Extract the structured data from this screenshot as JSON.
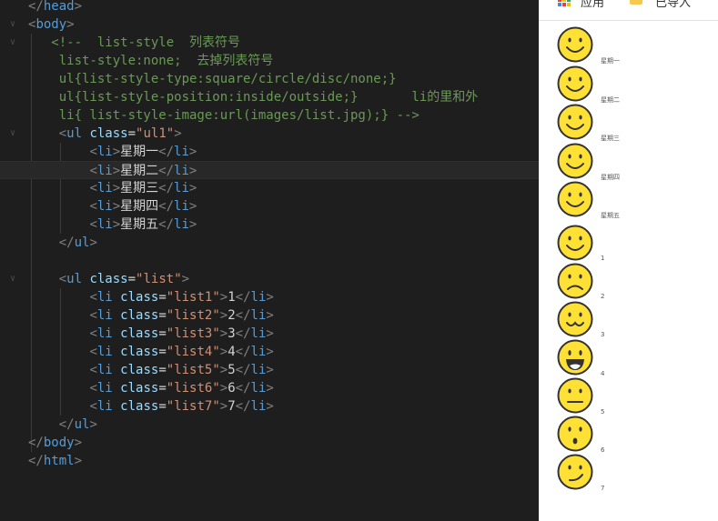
{
  "editor": {
    "lines": [
      [
        [
          "t",
          "</"
        ],
        [
          "tag",
          "head"
        ],
        [
          "t",
          ">"
        ]
      ],
      [
        [
          "t",
          "<"
        ],
        [
          "tag",
          "body"
        ],
        [
          "t",
          ">"
        ]
      ],
      [
        [
          "txt",
          "   "
        ],
        [
          "cmt",
          "<!--  list-style  列表符号"
        ]
      ],
      [
        [
          "cmt",
          "    list-style:none;  去掉列表符号"
        ]
      ],
      [
        [
          "cmt",
          "    ul{list-style-type:square/circle/disc/none;}"
        ]
      ],
      [
        [
          "cmt",
          "    ul{list-style-position:inside/outside;}       li的里和外"
        ]
      ],
      [
        [
          "cmt",
          "    li{ list-style-image:url(images/list.jpg);} -->"
        ]
      ],
      [
        [
          "txt",
          "    "
        ],
        [
          "t",
          "<"
        ],
        [
          "tag",
          "ul"
        ],
        [
          "txt",
          " "
        ],
        [
          "attr",
          "class"
        ],
        [
          "txt",
          "="
        ],
        [
          "str",
          "\"ul1\""
        ],
        [
          "t",
          ">"
        ]
      ],
      [
        [
          "txt",
          "        "
        ],
        [
          "t",
          "<"
        ],
        [
          "tag",
          "li"
        ],
        [
          "t",
          ">"
        ],
        [
          "txt",
          "星期一"
        ],
        [
          "t",
          "</"
        ],
        [
          "tag",
          "li"
        ],
        [
          "t",
          ">"
        ]
      ],
      [
        [
          "txt",
          "        "
        ],
        [
          "t",
          "<"
        ],
        [
          "tag",
          "li"
        ],
        [
          "t",
          ">"
        ],
        [
          "txt",
          "星期二"
        ],
        [
          "t",
          "</"
        ],
        [
          "tag",
          "li"
        ],
        [
          "t",
          ">"
        ]
      ],
      [
        [
          "txt",
          "        "
        ],
        [
          "t",
          "<"
        ],
        [
          "tag",
          "li"
        ],
        [
          "t",
          ">"
        ],
        [
          "txt",
          "星期三"
        ],
        [
          "t",
          "</"
        ],
        [
          "tag",
          "li"
        ],
        [
          "t",
          ">"
        ]
      ],
      [
        [
          "txt",
          "        "
        ],
        [
          "t",
          "<"
        ],
        [
          "tag",
          "li"
        ],
        [
          "t",
          ">"
        ],
        [
          "txt",
          "星期四"
        ],
        [
          "t",
          "</"
        ],
        [
          "tag",
          "li"
        ],
        [
          "t",
          ">"
        ]
      ],
      [
        [
          "txt",
          "        "
        ],
        [
          "t",
          "<"
        ],
        [
          "tag",
          "li"
        ],
        [
          "t",
          ">"
        ],
        [
          "txt",
          "星期五"
        ],
        [
          "t",
          "</"
        ],
        [
          "tag",
          "li"
        ],
        [
          "t",
          ">"
        ]
      ],
      [
        [
          "txt",
          "    "
        ],
        [
          "t",
          "</"
        ],
        [
          "tag",
          "ul"
        ],
        [
          "t",
          ">"
        ]
      ],
      [],
      [
        [
          "txt",
          "    "
        ],
        [
          "t",
          "<"
        ],
        [
          "tag",
          "ul"
        ],
        [
          "txt",
          " "
        ],
        [
          "attr",
          "class"
        ],
        [
          "txt",
          "="
        ],
        [
          "str",
          "\"list\""
        ],
        [
          "t",
          ">"
        ]
      ],
      [
        [
          "txt",
          "        "
        ],
        [
          "t",
          "<"
        ],
        [
          "tag",
          "li"
        ],
        [
          "txt",
          " "
        ],
        [
          "attr",
          "class"
        ],
        [
          "txt",
          "="
        ],
        [
          "str",
          "\"list1\""
        ],
        [
          "t",
          ">"
        ],
        [
          "txt",
          "1"
        ],
        [
          "t",
          "</"
        ],
        [
          "tag",
          "li"
        ],
        [
          "t",
          ">"
        ]
      ],
      [
        [
          "txt",
          "        "
        ],
        [
          "t",
          "<"
        ],
        [
          "tag",
          "li"
        ],
        [
          "txt",
          " "
        ],
        [
          "attr",
          "class"
        ],
        [
          "txt",
          "="
        ],
        [
          "str",
          "\"list2\""
        ],
        [
          "t",
          ">"
        ],
        [
          "txt",
          "2"
        ],
        [
          "t",
          "</"
        ],
        [
          "tag",
          "li"
        ],
        [
          "t",
          ">"
        ]
      ],
      [
        [
          "txt",
          "        "
        ],
        [
          "t",
          "<"
        ],
        [
          "tag",
          "li"
        ],
        [
          "txt",
          " "
        ],
        [
          "attr",
          "class"
        ],
        [
          "txt",
          "="
        ],
        [
          "str",
          "\"list3\""
        ],
        [
          "t",
          ">"
        ],
        [
          "txt",
          "3"
        ],
        [
          "t",
          "</"
        ],
        [
          "tag",
          "li"
        ],
        [
          "t",
          ">"
        ]
      ],
      [
        [
          "txt",
          "        "
        ],
        [
          "t",
          "<"
        ],
        [
          "tag",
          "li"
        ],
        [
          "txt",
          " "
        ],
        [
          "attr",
          "class"
        ],
        [
          "txt",
          "="
        ],
        [
          "str",
          "\"list4\""
        ],
        [
          "t",
          ">"
        ],
        [
          "txt",
          "4"
        ],
        [
          "t",
          "</"
        ],
        [
          "tag",
          "li"
        ],
        [
          "t",
          ">"
        ]
      ],
      [
        [
          "txt",
          "        "
        ],
        [
          "t",
          "<"
        ],
        [
          "tag",
          "li"
        ],
        [
          "txt",
          " "
        ],
        [
          "attr",
          "class"
        ],
        [
          "txt",
          "="
        ],
        [
          "str",
          "\"list5\""
        ],
        [
          "t",
          ">"
        ],
        [
          "txt",
          "5"
        ],
        [
          "t",
          "</"
        ],
        [
          "tag",
          "li"
        ],
        [
          "t",
          ">"
        ]
      ],
      [
        [
          "txt",
          "        "
        ],
        [
          "t",
          "<"
        ],
        [
          "tag",
          "li"
        ],
        [
          "txt",
          " "
        ],
        [
          "attr",
          "class"
        ],
        [
          "txt",
          "="
        ],
        [
          "str",
          "\"list6\""
        ],
        [
          "t",
          ">"
        ],
        [
          "txt",
          "6"
        ],
        [
          "t",
          "</"
        ],
        [
          "tag",
          "li"
        ],
        [
          "t",
          ">"
        ]
      ],
      [
        [
          "txt",
          "        "
        ],
        [
          "t",
          "<"
        ],
        [
          "tag",
          "li"
        ],
        [
          "txt",
          " "
        ],
        [
          "attr",
          "class"
        ],
        [
          "txt",
          "="
        ],
        [
          "str",
          "\"list7\""
        ],
        [
          "t",
          ">"
        ],
        [
          "txt",
          "7"
        ],
        [
          "t",
          "</"
        ],
        [
          "tag",
          "li"
        ],
        [
          "t",
          ">"
        ]
      ],
      [
        [
          "txt",
          "    "
        ],
        [
          "t",
          "</"
        ],
        [
          "tag",
          "ul"
        ],
        [
          "t",
          ">"
        ]
      ],
      [
        [
          "t",
          "</"
        ],
        [
          "tag",
          "body"
        ],
        [
          "t",
          ">"
        ]
      ],
      [
        [
          "t",
          "</"
        ],
        [
          "tag",
          "html"
        ],
        [
          "t",
          ">"
        ]
      ]
    ],
    "current_line": 9,
    "fold_lines": [
      1,
      2,
      7,
      15
    ]
  },
  "colors": {
    "editor_bg": "#1e1e1e",
    "tag": "#569cd6",
    "attribute": "#9cdcfe",
    "string": "#ce9178",
    "comment": "#6a9955",
    "text": "#d4d4d4",
    "bracket": "#808080",
    "smiley_fill": "#ffe135",
    "smiley_stroke": "#333333"
  },
  "browser": {
    "bookmarks": [
      {
        "icon": "apps-grid-icon",
        "label": "应用"
      },
      {
        "icon": "folder-icon",
        "label": "已导入"
      }
    ],
    "list_ul1": [
      {
        "label": "星期一",
        "face": "smile"
      },
      {
        "label": "星期二",
        "face": "smile"
      },
      {
        "label": "星期三",
        "face": "smile"
      },
      {
        "label": "星期四",
        "face": "smile"
      },
      {
        "label": "星期五",
        "face": "smile"
      }
    ],
    "list_list": [
      {
        "label": "1",
        "face": "smile"
      },
      {
        "label": "2",
        "face": "sad"
      },
      {
        "label": "3",
        "face": "cat-smile"
      },
      {
        "label": "4",
        "face": "laugh"
      },
      {
        "label": "5",
        "face": "neutral"
      },
      {
        "label": "6",
        "face": "surprised"
      },
      {
        "label": "7",
        "face": "smirk"
      }
    ]
  }
}
